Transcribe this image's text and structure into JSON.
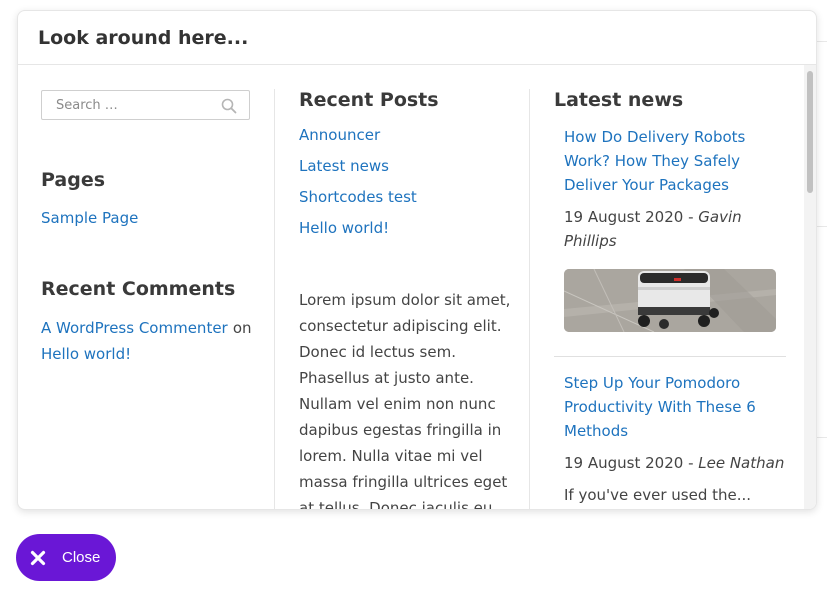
{
  "panel": {
    "title": "Look around here..."
  },
  "search": {
    "placeholder": "Search …"
  },
  "pages_widget": {
    "title": "Pages",
    "links": [
      "Sample Page"
    ]
  },
  "recent_comments": {
    "title": "Recent Comments",
    "author": "A WordPress Commenter",
    "on": "on",
    "post": "Hello world!"
  },
  "recent_posts": {
    "title": "Recent Posts",
    "items": [
      "Announcer",
      "Latest news",
      "Shortcodes test",
      "Hello world!"
    ]
  },
  "text_widget": {
    "body": "Lorem ipsum dolor sit amet, consectetur adipiscing elit. Donec id lectus sem. Phasellus at justo ante. Nullam vel enim non nunc dapibus egestas fringilla in lorem. Nulla vitae mi vel massa fringilla ultrices eget at tellus. Donec iaculis eu eros efficitur ob..."
  },
  "latest_news": {
    "title": "Latest news",
    "items": [
      {
        "title": "How Do Delivery Robots Work? How They Safely Deliver Your Packages",
        "date": "19 August 2020",
        "separator": " - ",
        "author": "Gavin Phillips"
      },
      {
        "title": "Step Up Your Pomodoro Productivity With These 6 Methods",
        "date": "19 August 2020",
        "separator": " - ",
        "author": "Lee Nathan",
        "excerpt": "If you've ever used the..."
      }
    ]
  },
  "close_button": {
    "label": "Close"
  },
  "colors": {
    "link": "#1e73be",
    "accent": "#6a17d6"
  }
}
